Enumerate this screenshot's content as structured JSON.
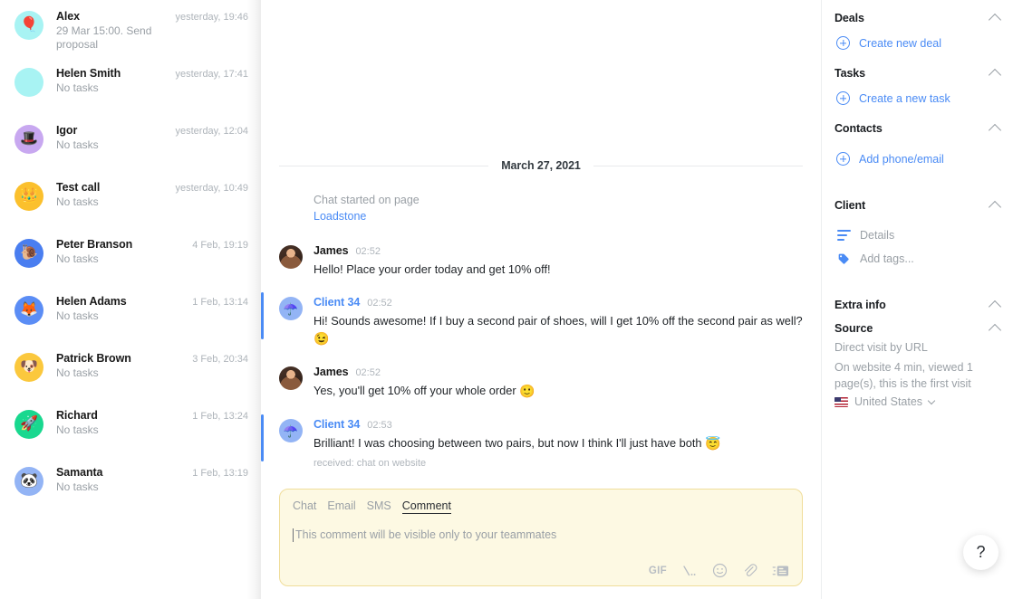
{
  "sidebar": {
    "conversations": [
      {
        "name": "Alex",
        "subtitle": "29 Mar 15:00. Send proposal",
        "time": "yesterday, 19:46",
        "avatar_emoji": "🎈",
        "avatar_color": "#a8f3f3"
      },
      {
        "name": "Helen Smith",
        "subtitle": "No tasks",
        "time": "yesterday, 17:41",
        "avatar_emoji": "",
        "avatar_color": "#a8f3f3"
      },
      {
        "name": "Igor",
        "subtitle": "No tasks",
        "time": "yesterday, 12:04",
        "avatar_emoji": "🎩",
        "avatar_color": "#c8a8f0"
      },
      {
        "name": "Test call",
        "subtitle": "No tasks",
        "time": "yesterday, 10:49",
        "avatar_emoji": "👑",
        "avatar_color": "#fbc02d"
      },
      {
        "name": "Peter Branson",
        "subtitle": "No tasks",
        "time": "4 Feb, 19:19",
        "avatar_emoji": "🐌",
        "avatar_color": "#4a7ef0"
      },
      {
        "name": "Helen Adams",
        "subtitle": "No tasks",
        "time": "1 Feb, 13:14",
        "avatar_emoji": "🦊",
        "avatar_color": "#5b8df5"
      },
      {
        "name": "Patrick Brown",
        "subtitle": "No tasks",
        "time": "3 Feb, 20:34",
        "avatar_emoji": "🐶",
        "avatar_color": "#fbc83d"
      },
      {
        "name": "Richard",
        "subtitle": "No tasks",
        "time": "1 Feb, 13:24",
        "avatar_emoji": "🚀",
        "avatar_color": "#19d88f"
      },
      {
        "name": "Samanta",
        "subtitle": "No tasks",
        "time": "1 Feb, 13:19",
        "avatar_emoji": "🐼",
        "avatar_color": "#93b4f5"
      }
    ]
  },
  "chat": {
    "date_separator": "March 27, 2021",
    "system": {
      "line1": "Chat started on page",
      "page_link": "Loadstone"
    },
    "messages": [
      {
        "author": "James",
        "time": "02:52",
        "text": "Hello! Place your order today and get 10% off!",
        "emoji": "",
        "meta": "",
        "direction": "outbound",
        "avatar_emoji": "",
        "avatar_color": "#3b2a20"
      },
      {
        "author": "Client 34",
        "time": "02:52",
        "text": "Hi! Sounds awesome! If I buy a second pair of shoes, will I get 10% off the second pair as well?",
        "emoji": "😉",
        "meta": "",
        "direction": "inbound",
        "avatar_emoji": "☂️",
        "avatar_color": "#93b4f5"
      },
      {
        "author": "James",
        "time": "02:52",
        "text": "Yes, you'll get 10% off your whole order",
        "emoji": "🙂",
        "meta": "",
        "direction": "outbound",
        "avatar_emoji": "",
        "avatar_color": "#3b2a20"
      },
      {
        "author": "Client 34",
        "time": "02:53",
        "text": "Brilliant! I was choosing between two pairs, but now I think I'll just have both",
        "emoji": "😇",
        "meta": "received: chat on website",
        "direction": "inbound",
        "avatar_emoji": "☂️",
        "avatar_color": "#93b4f5"
      }
    ]
  },
  "composer": {
    "tabs": [
      {
        "label": "Chat",
        "active": false
      },
      {
        "label": "Email",
        "active": false
      },
      {
        "label": "SMS",
        "active": false
      },
      {
        "label": "Comment",
        "active": true
      }
    ],
    "value": "",
    "placeholder": "This comment will be visible only to your teammates",
    "tools": [
      {
        "name": "gif-button",
        "label": "GIF"
      },
      {
        "name": "canned-response-icon",
        "label": "\\.."
      },
      {
        "name": "emoji-icon",
        "label": "☺"
      },
      {
        "name": "attachment-icon",
        "label": "📎"
      },
      {
        "name": "template-icon",
        "label": "☰"
      }
    ]
  },
  "right_panel": {
    "deals": {
      "title": "Deals",
      "action": "Create new deal"
    },
    "tasks": {
      "title": "Tasks",
      "action": "Create a new task"
    },
    "contacts": {
      "title": "Contacts",
      "action": "Add phone/email"
    },
    "client": {
      "title": "Client",
      "details_label": "Details",
      "tags_label": "Add tags..."
    },
    "extra_info": {
      "title": "Extra info"
    },
    "source": {
      "title": "Source",
      "line1": "Direct visit by URL",
      "line2": "On website 4 min, viewed 1 page(s), this is the first visit",
      "country": "United States"
    }
  },
  "help": {
    "label": "?"
  },
  "colors": {
    "accent_blue": "#4a8bf5",
    "comment_bg": "#fdf9e3",
    "comment_border": "#f0dd9a",
    "muted_text": "#9aa0a6"
  }
}
